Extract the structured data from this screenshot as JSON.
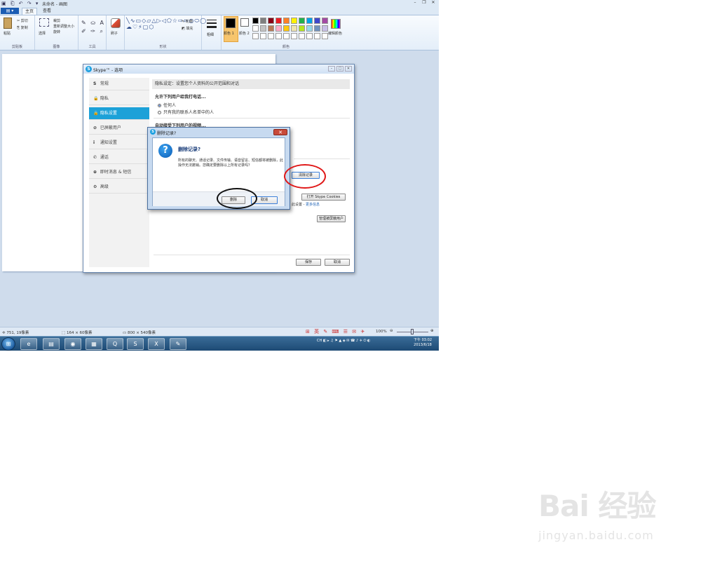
{
  "paint": {
    "title": "未命名 - 画图",
    "file_tab": "▤ ▾",
    "tabs": [
      "主页",
      "查看"
    ],
    "clipboard": {
      "paste": "粘贴",
      "cut": "剪切",
      "copy": "复制",
      "group": "剪贴板"
    },
    "image": {
      "select": "选择",
      "crop": "裁剪",
      "resize": "重新调整大小",
      "rotate": "旋转",
      "group": "图像"
    },
    "tools": {
      "group": "工具"
    },
    "brushes": {
      "label": "刷子"
    },
    "shapes": {
      "outline": "轮廓",
      "fill": "填充",
      "group": "形状"
    },
    "size": {
      "label": "粗细"
    },
    "colors": {
      "color1": "颜色 1",
      "color2": "颜色 2",
      "edit": "编辑颜色",
      "group": "颜色",
      "palette": [
        "#000000",
        "#7f7f7f",
        "#880015",
        "#ed1c24",
        "#ff7f27",
        "#fff200",
        "#22b14c",
        "#00a2e8",
        "#3f48cc",
        "#a349a4",
        "#ffffff",
        "#c3c3c3",
        "#b97a57",
        "#ffaec9",
        "#ffc90e",
        "#efe4b0",
        "#b5e61d",
        "#99d9ea",
        "#7092be",
        "#c8bfe7",
        "#ffffff",
        "#ffffff",
        "#ffffff",
        "#ffffff",
        "#ffffff",
        "#ffffff",
        "#ffffff",
        "#ffffff",
        "#ffffff",
        "#ffffff"
      ]
    }
  },
  "skype": {
    "title": "Skype™ - 选项",
    "nav": [
      {
        "icon": "S",
        "label": "常规"
      },
      {
        "icon": "🔒",
        "label": "隐私"
      },
      {
        "icon": "🔒",
        "label": "隐私设置"
      },
      {
        "icon": "⊘",
        "label": "已屏蔽用户"
      },
      {
        "icon": "i",
        "label": "通知设置"
      },
      {
        "icon": "✆",
        "label": "通话"
      },
      {
        "icon": "⊕",
        "label": "即时消息 & 短信"
      },
      {
        "icon": "⚙",
        "label": "高级"
      }
    ],
    "content_head": "隐私设定：设置您个人资料的公开范围和对话",
    "section1": "允许下列用户给我打电话...",
    "radio1": "任何人",
    "radio2": "只有我的联系人名单中的人",
    "section2": "自动接受下列用户的视频...",
    "btn_clear_history": "清除记录",
    "btn_open_cookies": "打开 Skype Cookies",
    "link_prefix": "此设置",
    "link_text": "更多信息",
    "btn_blocked": "管理被屏蔽用户",
    "btn_save": "保存",
    "btn_cancel": "取消"
  },
  "confirm": {
    "title": "删除记录?",
    "heading": "删除记录?",
    "message": "所有的聊天、通话记录、文件传输、语音留言、短信都将被删除，此操作无法撤销。您确定要删除以上所有记录吗？",
    "btn_delete": "删除",
    "btn_cancel": "取消"
  },
  "statusbar": {
    "cursor": "751, 19像素",
    "selection": "164 × 60像素",
    "image_size": "800 × 540像素",
    "zoom": "100%"
  },
  "taskbar": {
    "apps": [
      "ie-icon",
      "explorer-icon",
      "chrome-icon",
      "paint-icon",
      "qq-icon",
      "skype-icon",
      "excel-icon",
      "tool-icon"
    ],
    "tray": "CH",
    "time": "下午 03:02",
    "date": "2013/6/18"
  },
  "watermark": {
    "text": "Bai 经验",
    "url": "jingyan.baidu.com"
  }
}
